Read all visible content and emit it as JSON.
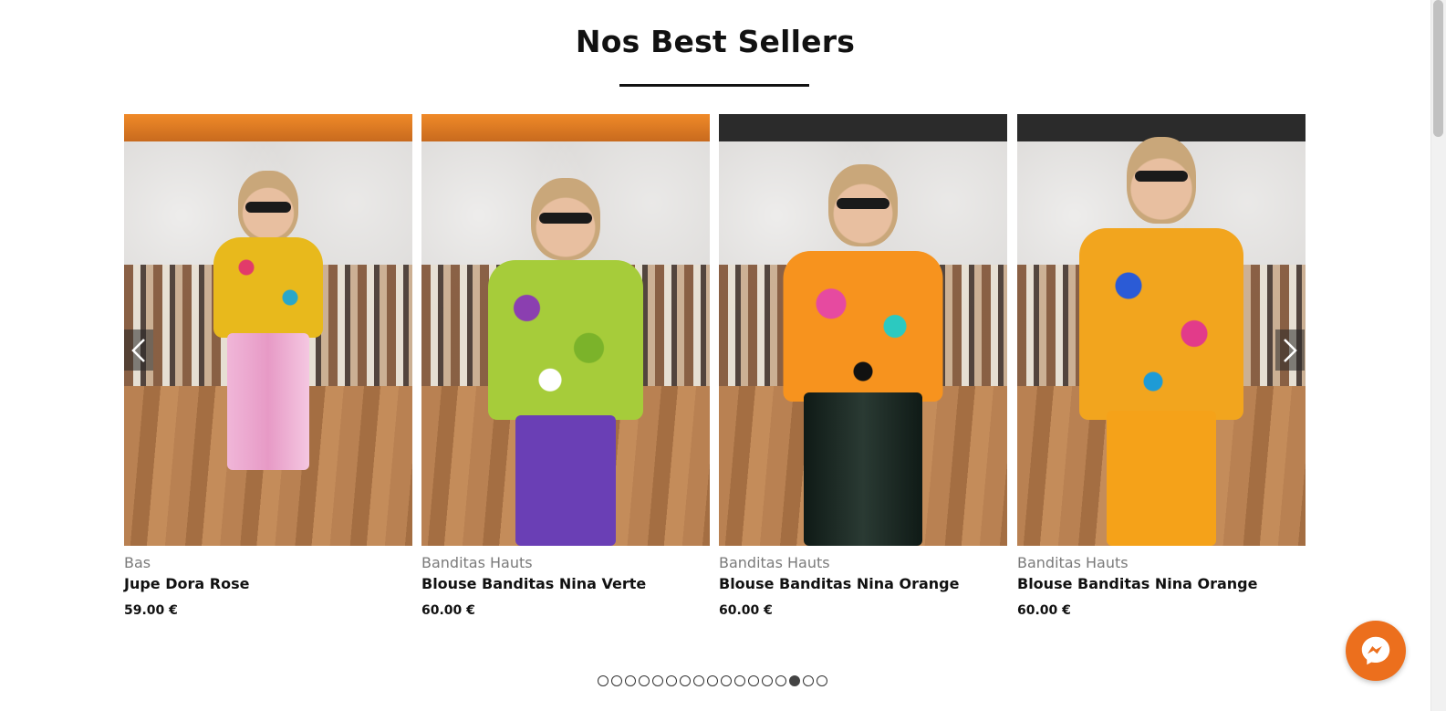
{
  "section": {
    "title": "Nos Best Sellers"
  },
  "products": [
    {
      "category": "Bas",
      "name": "Jupe Dora Rose",
      "price": "59.00 €"
    },
    {
      "category": "Banditas Hauts",
      "name": "Blouse Banditas Nina Verte",
      "price": "60.00 €"
    },
    {
      "category": "Banditas Hauts",
      "name": "Blouse Banditas Nina Orange",
      "price": "60.00 €"
    },
    {
      "category": "Banditas Hauts",
      "name": "Blouse Banditas Nina Orange",
      "price": "60.00 €"
    }
  ],
  "carousel": {
    "prev_icon": "chevron-left-icon",
    "next_icon": "chevron-right-icon",
    "dot_count": 17,
    "active_dot_index": 14
  },
  "colors": {
    "accent": "#ec6f1d",
    "text": "#111111",
    "category": "#7a7a7a"
  },
  "chat": {
    "icon": "messenger-icon"
  }
}
